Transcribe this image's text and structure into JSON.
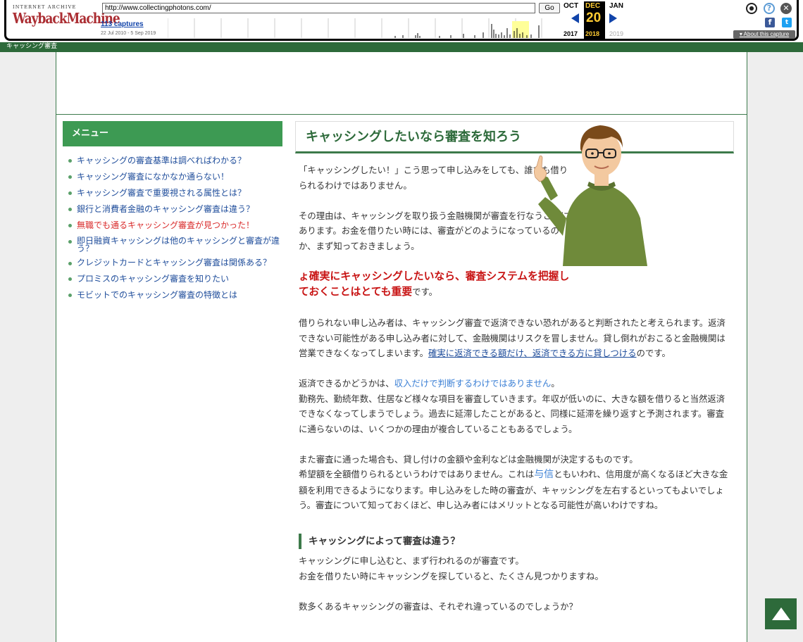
{
  "wayback": {
    "logo_top": "INTERNET ARCHIVE",
    "logo_main": "WaybackMachine",
    "url": "http://www.collectingphotons.com/",
    "go_label": "Go",
    "captures": "113 captures",
    "date_range": "22 Jul 2010 - 5 Sep 2019",
    "month_prev": "OCT",
    "month_cur": "DEC",
    "month_next": "JAN",
    "day": "20",
    "year_prev": "2017",
    "year_cur": "2018",
    "year_next": "2019",
    "about": "About this capture",
    "colors": {
      "logo": "#ab2e33",
      "highlight": "#ffcc33",
      "link": "#1144aa"
    }
  },
  "strip": {
    "title": "キャッシング審査"
  },
  "sidebar": {
    "heading": "メニュー",
    "items": [
      {
        "label": "キャッシングの審査基準は調べればわかる？"
      },
      {
        "label": "キャッシング審査になかなか通らない！"
      },
      {
        "label": "キャッシング審査で重要視される属性とは？"
      },
      {
        "label": "銀行と消費者金融のキャッシング審査は違う？"
      },
      {
        "label": "無職でも通るキャッシング審査が見つかった！"
      },
      {
        "label": "即日融資キャッシングは他のキャッシングと審査が違う？"
      },
      {
        "label": "クレジットカードとキャッシング審査は関係ある？"
      },
      {
        "label": "プロミスのキャッシング審査を知りたい"
      },
      {
        "label": "モビットでのキャッシング審査の特徴とは"
      }
    ]
  },
  "main": {
    "title": "キャッシングしたいなら審査を知ろう",
    "p1": "「キャッシングしたい！」こう思って申し込みをしても、誰でも借りられるわけではありません。",
    "p2": "その理由は、キャッシングを取り扱う金融機関が審査を行なうことにあります。お金を借りたい時には、審査がどのようになっているのか、まず知っておきましょう。",
    "p3_red": "ょ確実にキャッシングしたいなら、審査システムを把握しておくことはとても重要",
    "p3_tail": "です。",
    "p4a": "借りられない申し込み者は、キャッシング審査で返済できない恐れがあると判断されたと考えられます。返済できない可能性がある申し込み者に対して、金融機関はリスクを冒しません。貸し倒れがおこると金融機関は営業できなくなってしまいます。",
    "p4_link": "確実に返済できる額だけ、返済できる方に貸しつける",
    "p4_tail": "のです。",
    "p5a": "返済できるかどうかは、",
    "p5_blue": "収入だけで判断するわけではありません",
    "p5b": "。",
    "p5c": "勤務先、勤続年数、住居など様々な項目を審査していきます。年収が低いのに、大きな額を借りると当然返済できなくなってしまうでしょう。過去に延滞したことがあると、同様に延滞を繰り返すと予測されます。審査に通らないのは、いくつかの理由が複合していることもあるでしょう。",
    "p6a": "また審査に通った場合も、貸し付けの金額や金利などは金融機関が決定するものです。",
    "p6b": "希望額を全額借りられるというわけではありません。これは",
    "p6_blue": "与信",
    "p6c": "ともいわれ、信用度が高くなるほど大きな金額を利用できるようになります。申し込みをした時の審査が、キャッシングを左右するといってもよいでしょう。審査について知っておくほど、申し込み者にはメリットとなる可能性が高いわけですね。",
    "h3": "キャッシングによって審査は違う？",
    "p7a": "キャッシングに申し込むと、まず行われるのが審査です。",
    "p7b": "お金を借りたい時にキャッシングを探していると、たくさん見つかりますね。",
    "p8": "数多くあるキャッシングの審査は、それぞれ違っているのでしょうか？"
  }
}
